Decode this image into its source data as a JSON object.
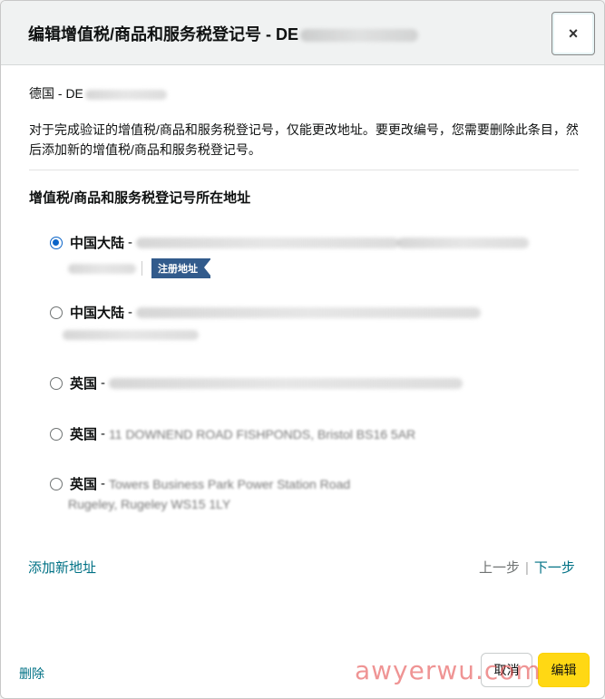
{
  "dialog": {
    "title": "编辑增值税/商品和服务税登记号 - DE",
    "close_label": "×"
  },
  "country_line": "德国 - DE",
  "notice": "对于完成验证的增值税/商品和服务税登记号，仅能更改地址。要更改编号，您需要删除此条目，然后添加新的增值税/商品和服务税登记号。",
  "section_title": "增值税/商品和服务税登记号所在地址",
  "addresses": [
    {
      "country": "中国大陆",
      "line1": "Shenzhen, Guangdong",
      "selected": true,
      "badge": "注册地址"
    },
    {
      "country": "中国大陆",
      "line1": "District",
      "selected": false
    },
    {
      "country": "英国",
      "line1": "AVENUE",
      "selected": false
    },
    {
      "country": "英国",
      "line1": "11 DOWNEND ROAD FISHPONDS, Bristol BS16 5AR",
      "selected": false
    },
    {
      "country": "英国",
      "line1": "Towers Business Park Power Station Road",
      "line2": "Rugeley, Rugeley WS15 1LY",
      "selected": false
    }
  ],
  "links": {
    "add_address": "添加新地址",
    "prev": "上一步",
    "next": "下一步",
    "delete": "删除"
  },
  "buttons": {
    "cancel": "取消",
    "edit": "编辑"
  },
  "watermark": "awyerwu.com",
  "colors": {
    "accent": "#007185",
    "primary_button": "#ffd814",
    "badge": "#325b8c",
    "radio": "#0a64c8"
  }
}
